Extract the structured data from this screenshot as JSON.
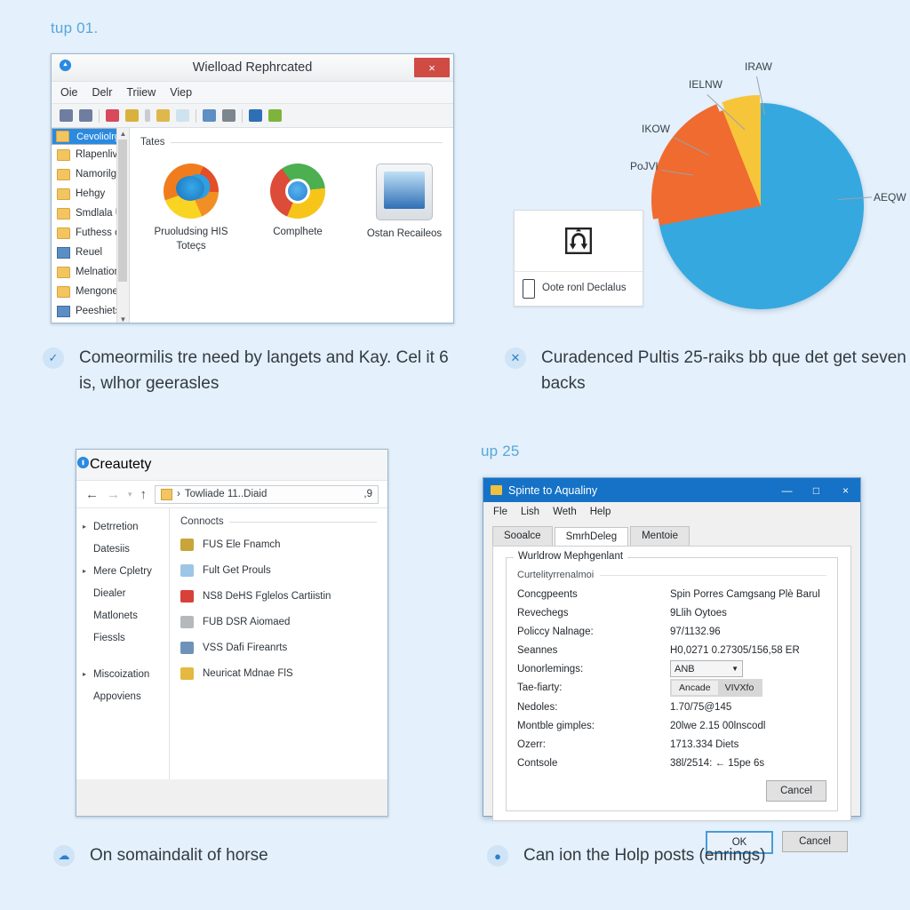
{
  "page": {
    "background_color": "#e4f0fb",
    "accent_color": "#57a8d8"
  },
  "quadrant_top_left": {
    "heading": "tup 01.",
    "window": {
      "title": "Wielload Rephrcated",
      "close_label": "×",
      "menu": [
        "Oie",
        "Delr",
        "Triiew",
        "Viep"
      ],
      "tree_items": [
        {
          "label": "Cevoliolrg",
          "icon": "folder-icon",
          "selected": true
        },
        {
          "label": "Rlapenlives",
          "icon": "folder-icon",
          "selected": false
        },
        {
          "label": "Namorilg",
          "icon": "folder-icon",
          "selected": false
        },
        {
          "label": "Hehgy",
          "icon": "folder-icon",
          "selected": false
        },
        {
          "label": "Smdlala Unalties",
          "icon": "folder-icon",
          "selected": false
        },
        {
          "label": "Futhess confirc Masic",
          "icon": "folder-icon",
          "selected": false
        },
        {
          "label": "Reuel",
          "icon": "window-icon",
          "selected": false
        },
        {
          "label": "Melnatiom",
          "icon": "folder-icon",
          "selected": false
        },
        {
          "label": "Mengones",
          "icon": "folder-icon",
          "selected": false
        },
        {
          "label": "Peeshiets",
          "icon": "window-icon",
          "selected": false
        }
      ],
      "content_group_label": "Tates",
      "apps": [
        {
          "name": "Pruoludsing HIS Toteçs",
          "icon": "firefox-icon"
        },
        {
          "name": "Complhete",
          "icon": "chrome-icon"
        },
        {
          "name": "Ostan Recaileos",
          "icon": "explorer-icon"
        }
      ]
    },
    "caption": {
      "icon": "check-circle-icon",
      "text": "Comeormilis tre need by langets and  Kay. Cel it 6 is, wlhor geerasles"
    }
  },
  "quadrant_top_right": {
    "card": {
      "icon": "sync-arrows-icon",
      "device_icon": "phone-icon",
      "text": "Oote ronl Declalus"
    },
    "caption": {
      "icon": "x-circle-icon",
      "text": "Curadenced Pultis 25-raiks  bb que det get seven backs"
    }
  },
  "chart_data": {
    "type": "pie",
    "title": "",
    "labels": [
      "AEQW",
      "PoJVl",
      "IKOW",
      "IELNW",
      "IRAW"
    ],
    "slice_labels": [
      "AEQW",
      "PoJVl",
      "IRAW"
    ],
    "categories": [
      "AEQW",
      "PoJVl",
      "IRAW"
    ],
    "values": [
      72,
      22,
      6
    ],
    "colors": [
      "#35a8e0",
      "#ef6b30",
      "#f7c53a"
    ],
    "annotations": [
      "IRAW",
      "IELNW",
      "IKOW",
      "PoJVl",
      "AEQW"
    ],
    "legend_position": "callout-labels",
    "grid": false
  },
  "quadrant_bottom_left": {
    "window": {
      "title": "Creautety",
      "nav": {
        "back": "←",
        "forward": "→",
        "history": "▾",
        "up": "↑"
      },
      "address_value": "Towliade 11..Diaid",
      "address_end": ",9",
      "nav_items": [
        {
          "label": "Detrretion",
          "expandable": true
        },
        {
          "label": "Datesiis",
          "expandable": false
        },
        {
          "label": "Mere Cpletry",
          "expandable": true
        },
        {
          "label": "Diealer",
          "expandable": false
        },
        {
          "label": "Matlonets",
          "expandable": false
        },
        {
          "label": "Fiessls",
          "expandable": false
        },
        {
          "label": "Miscoization",
          "expandable": true
        },
        {
          "label": "Appoviens",
          "expandable": false
        }
      ],
      "list_group_label": "Connocts",
      "files": [
        {
          "label": "FUS Ele Fnamch",
          "color": "#c9a43a"
        },
        {
          "label": "Fult Get Prouls",
          "color": "#9dc6e6"
        },
        {
          "label": "NS8 DeHS Fglelos Cartiistin",
          "color": "#d8403a"
        },
        {
          "label": "FUB DSR Aiomaed",
          "color": "#b6b9bc"
        },
        {
          "label": "VSS Dafi Fireanrts",
          "color": "#6f93b8"
        },
        {
          "label": "Neuricat Mdnae FlS",
          "color": "#e3b93f"
        }
      ]
    },
    "caption": {
      "icon": "cloud-circle-icon",
      "text": "On somaindalit of horse"
    }
  },
  "quadrant_bottom_right": {
    "heading": "up 25",
    "dialog": {
      "title": "Spinte to Aqualiny",
      "window_buttons": {
        "minimize": "—",
        "maximize": "□",
        "close": "×"
      },
      "menu": [
        "Fle",
        "Lish",
        "Weth",
        "Help"
      ],
      "tabs": [
        {
          "label": "Sooalce",
          "active": false
        },
        {
          "label": "SmrhDeleg",
          "active": true
        },
        {
          "label": "Mentoie",
          "active": false
        }
      ],
      "group_label": "Wurldrow Mephgenlant",
      "sub_label": "Curtelityrrenalmoi",
      "fields": [
        {
          "key": "Concgpeents",
          "value": "Spin Porres Camgsang Plè Barul",
          "type": "text"
        },
        {
          "key": "Revechegs",
          "value": "9Llih Oytoes",
          "type": "text"
        },
        {
          "key": "Policcy Nalnage:",
          "value": "97/1132.96",
          "type": "text"
        },
        {
          "key": "Seannes",
          "value": "H0,0271 0.27305/156,58 ER",
          "type": "text"
        },
        {
          "key": "Uonorlemings:",
          "value": "ANB",
          "type": "select"
        },
        {
          "key": "Tae-fiarty:",
          "value": "Ancade",
          "value2": "VIVXfo",
          "type": "segmented"
        },
        {
          "key": "Nedoles:",
          "value": "1.70/75@145",
          "type": "text"
        },
        {
          "key": "Montble gimples:",
          "value": "20lwe 2.15 00lnscodl",
          "type": "text"
        },
        {
          "key": "Ozerr:",
          "value": "1713.334 Diets",
          "type": "text"
        },
        {
          "key": "Contsole",
          "value": "38l/2514: ← 15pe 6s",
          "type": "text"
        }
      ],
      "inner_button": "Cancel",
      "ok_label": "OK",
      "cancel_label": "Cancel"
    },
    "caption": {
      "icon": "person-circle-icon",
      "text": "Can ion the Holp posts (enrings)"
    }
  }
}
